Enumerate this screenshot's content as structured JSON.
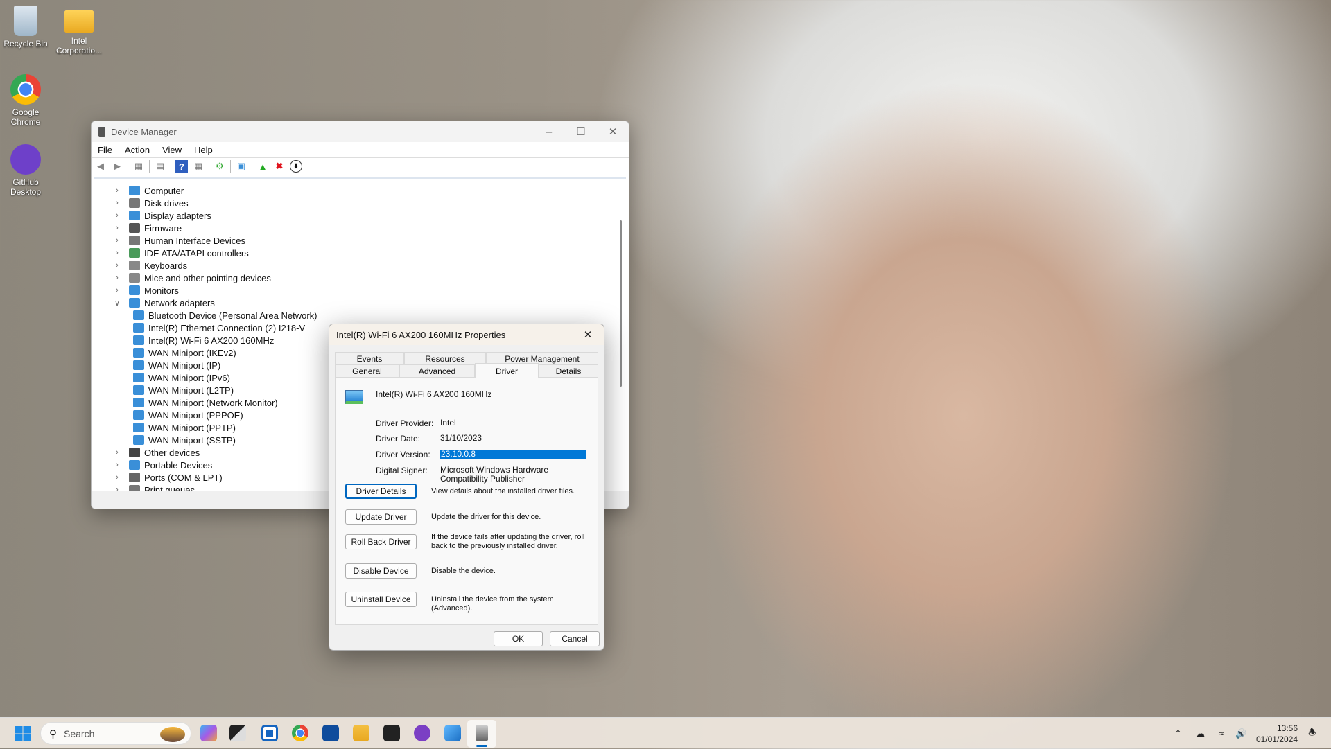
{
  "desktop": {
    "icons": [
      {
        "label": "Recycle Bin"
      },
      {
        "label": "Intel Corporatio..."
      },
      {
        "label": "Google Chrome"
      },
      {
        "label": "GitHub Desktop"
      }
    ]
  },
  "device_manager": {
    "title": "Device Manager",
    "menu": [
      "File",
      "Action",
      "View",
      "Help"
    ],
    "toolbar": [
      "back-icon",
      "forward-icon",
      "show-hide-console-tree-icon",
      "properties-icon",
      "help-icon",
      "action-pane-icon",
      "update-driver-icon",
      "scan-hardware-icon",
      "enable-device-icon",
      "uninstall-icon",
      "download-icon"
    ],
    "tree": [
      {
        "label": "Computer",
        "level": 0,
        "expanded": false,
        "color": "#3a8fd8"
      },
      {
        "label": "Disk drives",
        "level": 0,
        "expanded": false,
        "color": "#777"
      },
      {
        "label": "Display adapters",
        "level": 0,
        "expanded": false,
        "color": "#3a8fd8"
      },
      {
        "label": "Firmware",
        "level": 0,
        "expanded": false,
        "color": "#555"
      },
      {
        "label": "Human Interface Devices",
        "level": 0,
        "expanded": false,
        "color": "#777"
      },
      {
        "label": "IDE ATA/ATAPI controllers",
        "level": 0,
        "expanded": false,
        "color": "#4a9a5a"
      },
      {
        "label": "Keyboards",
        "level": 0,
        "expanded": false,
        "color": "#888"
      },
      {
        "label": "Mice and other pointing devices",
        "level": 0,
        "expanded": false,
        "color": "#888"
      },
      {
        "label": "Monitors",
        "level": 0,
        "expanded": false,
        "color": "#3a8fd8"
      },
      {
        "label": "Network adapters",
        "level": 0,
        "expanded": true,
        "color": "#3a8fd8"
      },
      {
        "label": "Bluetooth Device (Personal Area Network)",
        "level": 1,
        "color": "#3a8fd8"
      },
      {
        "label": "Intel(R) Ethernet Connection (2) I218-V",
        "level": 1,
        "color": "#3a8fd8"
      },
      {
        "label": "Intel(R) Wi-Fi 6 AX200 160MHz",
        "level": 1,
        "color": "#3a8fd8"
      },
      {
        "label": "WAN Miniport (IKEv2)",
        "level": 1,
        "color": "#3a8fd8"
      },
      {
        "label": "WAN Miniport (IP)",
        "level": 1,
        "color": "#3a8fd8"
      },
      {
        "label": "WAN Miniport (IPv6)",
        "level": 1,
        "color": "#3a8fd8"
      },
      {
        "label": "WAN Miniport (L2TP)",
        "level": 1,
        "color": "#3a8fd8"
      },
      {
        "label": "WAN Miniport (Network Monitor)",
        "level": 1,
        "color": "#3a8fd8"
      },
      {
        "label": "WAN Miniport (PPPOE)",
        "level": 1,
        "color": "#3a8fd8"
      },
      {
        "label": "WAN Miniport (PPTP)",
        "level": 1,
        "color": "#3a8fd8"
      },
      {
        "label": "WAN Miniport (SSTP)",
        "level": 1,
        "color": "#3a8fd8"
      },
      {
        "label": "Other devices",
        "level": 0,
        "expanded": false,
        "color": "#444"
      },
      {
        "label": "Portable Devices",
        "level": 0,
        "expanded": false,
        "color": "#3a8fd8"
      },
      {
        "label": "Ports (COM & LPT)",
        "level": 0,
        "expanded": false,
        "color": "#666"
      },
      {
        "label": "Print queues",
        "level": 0,
        "expanded": false,
        "color": "#777"
      }
    ]
  },
  "properties": {
    "title": "Intel(R) Wi-Fi 6 AX200 160MHz Properties",
    "tabs_top": [
      "Events",
      "Resources",
      "Power Management"
    ],
    "tabs_bottom": [
      "General",
      "Advanced",
      "Driver",
      "Details"
    ],
    "active_tab": "Driver",
    "device_name": "Intel(R) Wi-Fi 6 AX200 160MHz",
    "fields": [
      {
        "label": "Driver Provider:",
        "value": "Intel"
      },
      {
        "label": "Driver Date:",
        "value": "31/10/2023"
      },
      {
        "label": "Driver Version:",
        "value": "23.10.0.8"
      },
      {
        "label": "Digital Signer:",
        "value": "Microsoft Windows Hardware Compatibility Publisher"
      }
    ],
    "actions": [
      {
        "button": "Driver Details",
        "desc": "View details about the installed driver files."
      },
      {
        "button": "Update Driver",
        "desc": "Update the driver for this device."
      },
      {
        "button": "Roll Back Driver",
        "desc": "If the device fails after updating the driver, roll back to the previously installed driver."
      },
      {
        "button": "Disable Device",
        "desc": "Disable the device."
      },
      {
        "button": "Uninstall Device",
        "desc": "Uninstall the device from the system (Advanced)."
      }
    ],
    "ok": "OK",
    "cancel": "Cancel",
    "selection_color": "#0078d7"
  },
  "taskbar": {
    "search_placeholder": "Search",
    "apps": [
      "copilot-icon",
      "task-view-icon",
      "widgets-icon",
      "chrome-icon",
      "store-icon",
      "file-explorer-icon",
      "figma-icon",
      "github-desktop-icon",
      "photos-icon",
      "device-manager-icon"
    ],
    "time": "13:56",
    "date": "01/01/2024"
  }
}
